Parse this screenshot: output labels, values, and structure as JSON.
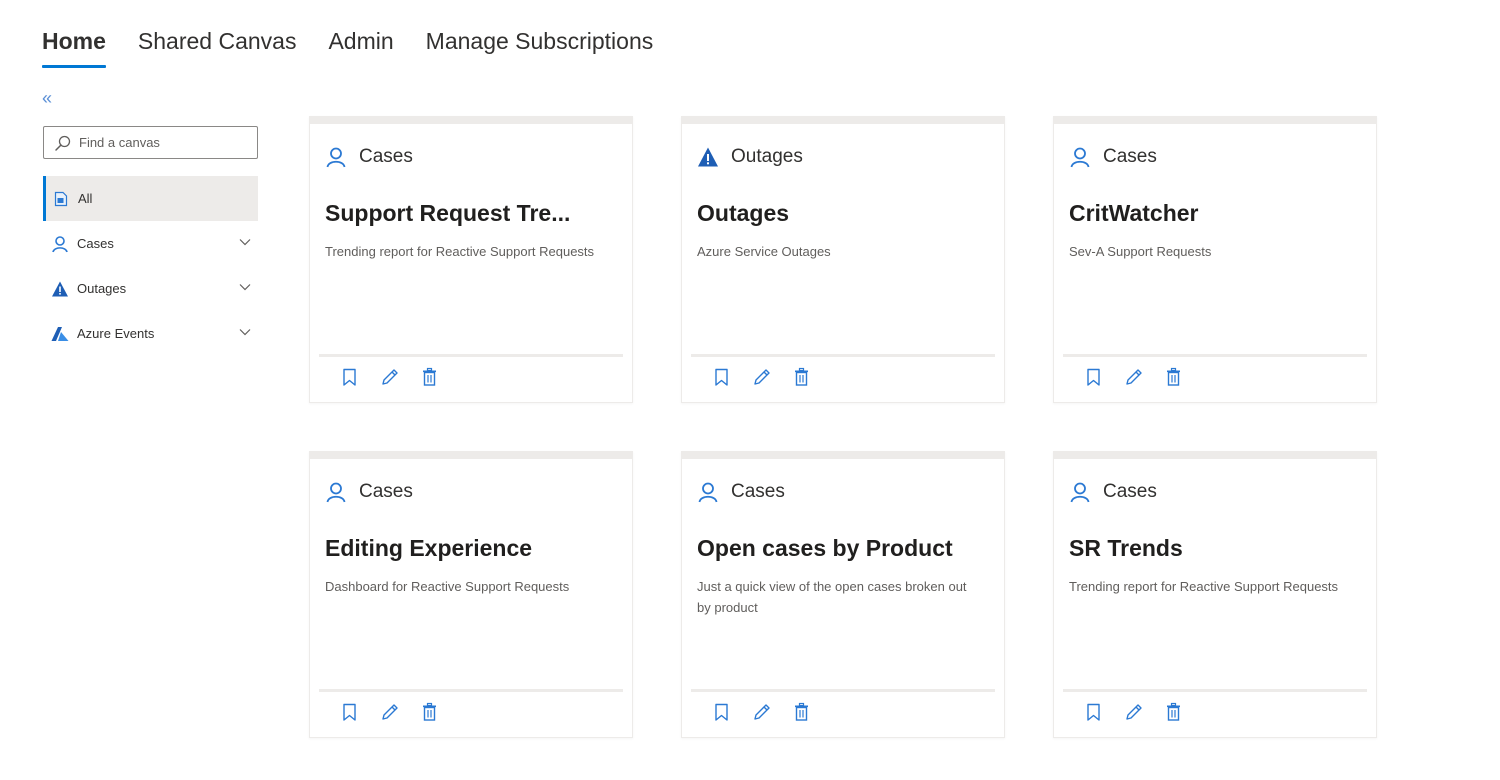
{
  "topnav": {
    "tabs": [
      {
        "label": "Home",
        "active": true
      },
      {
        "label": "Shared Canvas",
        "active": false
      },
      {
        "label": "Admin",
        "active": false
      },
      {
        "label": "Manage Subscriptions",
        "active": false
      }
    ]
  },
  "sidebar": {
    "collapse_icon": "double-chevron-left-icon",
    "search_placeholder": "Find a canvas",
    "items": [
      {
        "label": "All",
        "icon": "document-icon",
        "selected": true
      },
      {
        "label": "Cases",
        "icon": "person-icon",
        "expandable": true
      },
      {
        "label": "Outages",
        "icon": "warning-triangle-icon",
        "expandable": true
      },
      {
        "label": "Azure Events",
        "icon": "azure-logo-icon",
        "expandable": true
      }
    ]
  },
  "cards": [
    {
      "category": "Cases",
      "icon": "person-icon",
      "title": "Support Request Tre...",
      "description": "Trending report for Reactive Support Requests"
    },
    {
      "category": "Outages",
      "icon": "warning-triangle-icon",
      "title": "Outages",
      "description": "Azure Service Outages"
    },
    {
      "category": "Cases",
      "icon": "person-icon",
      "title": "CritWatcher",
      "description": "Sev-A Support Requests"
    },
    {
      "category": "Cases",
      "icon": "person-icon",
      "title": "Editing Experience",
      "description": "Dashboard for Reactive Support Requests"
    },
    {
      "category": "Cases",
      "icon": "person-icon",
      "title": "Open cases by Product",
      "description": "Just a quick view of the open cases broken out by product"
    },
    {
      "category": "Cases",
      "icon": "person-icon",
      "title": "SR Trends",
      "description": "Trending report for Reactive Support Requests"
    }
  ],
  "colors": {
    "accent": "#0078d4",
    "icon_blue": "#2b79d3",
    "card_border": "#edebe9"
  }
}
